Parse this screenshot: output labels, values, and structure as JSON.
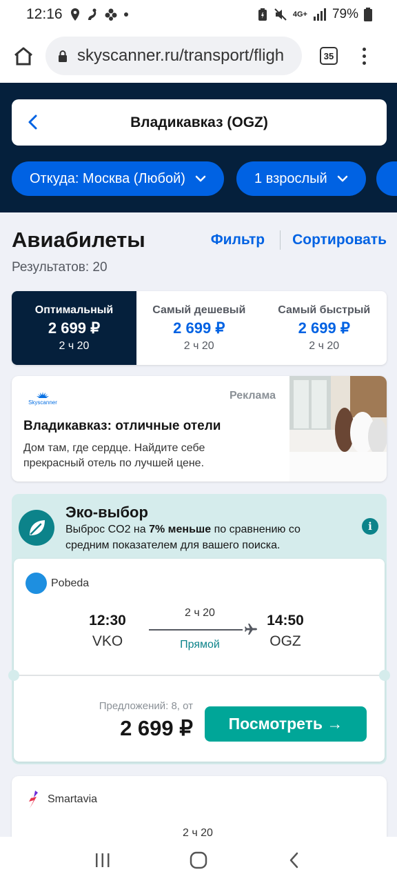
{
  "status_bar": {
    "time": "12:16",
    "network": "4G+",
    "battery": "79%"
  },
  "browser": {
    "url": "skyscanner.ru/transport/fligh",
    "tab_count": "35"
  },
  "header": {
    "destination": "Владикавказ (OGZ)",
    "from_pill": "Откуда: Москва (Любой)",
    "passengers_pill": "1 взрослый"
  },
  "results": {
    "title": "Авиабилеты",
    "filter_label": "Фильтр",
    "sort_label": "Сортировать",
    "count_text": "Результатов: 20"
  },
  "sort_tabs": [
    {
      "label": "Оптимальный",
      "price": "2 699 ₽",
      "duration": "2 ч 20",
      "active": true
    },
    {
      "label": "Самый дешевый",
      "price": "2 699 ₽",
      "duration": "2 ч 20",
      "active": false
    },
    {
      "label": "Самый быстрый",
      "price": "2 699 ₽",
      "duration": "2 ч 20",
      "active": false
    }
  ],
  "ad": {
    "brand": "Skyscanner",
    "label": "Реклама",
    "title": "Владикавказ: отличные отели",
    "text": "Дом там, где сердце. Найдите себе прекрасный отель по лучшей цене."
  },
  "eco": {
    "title": "Эко-выбор",
    "text_before": "Выброс CO2 на ",
    "text_bold": "7% меньше",
    "text_after": " по сравнению со средним показателем для вашего поиска."
  },
  "flights": [
    {
      "airline": "Pobeda",
      "dep_time": "12:30",
      "dep_code": "VKO",
      "arr_time": "14:50",
      "arr_code": "OGZ",
      "duration": "2 ч 20",
      "stops": "Прямой",
      "offers": "Предложений: 8, от",
      "price": "2 699 ₽",
      "button": "Посмотреть →"
    },
    {
      "airline": "Smartavia",
      "duration": "2 ч 20"
    }
  ],
  "colors": {
    "dark_navy": "#05203c",
    "brand_blue": "#0062e3",
    "eco_bg": "#d5ecec",
    "teal": "#00a698"
  }
}
